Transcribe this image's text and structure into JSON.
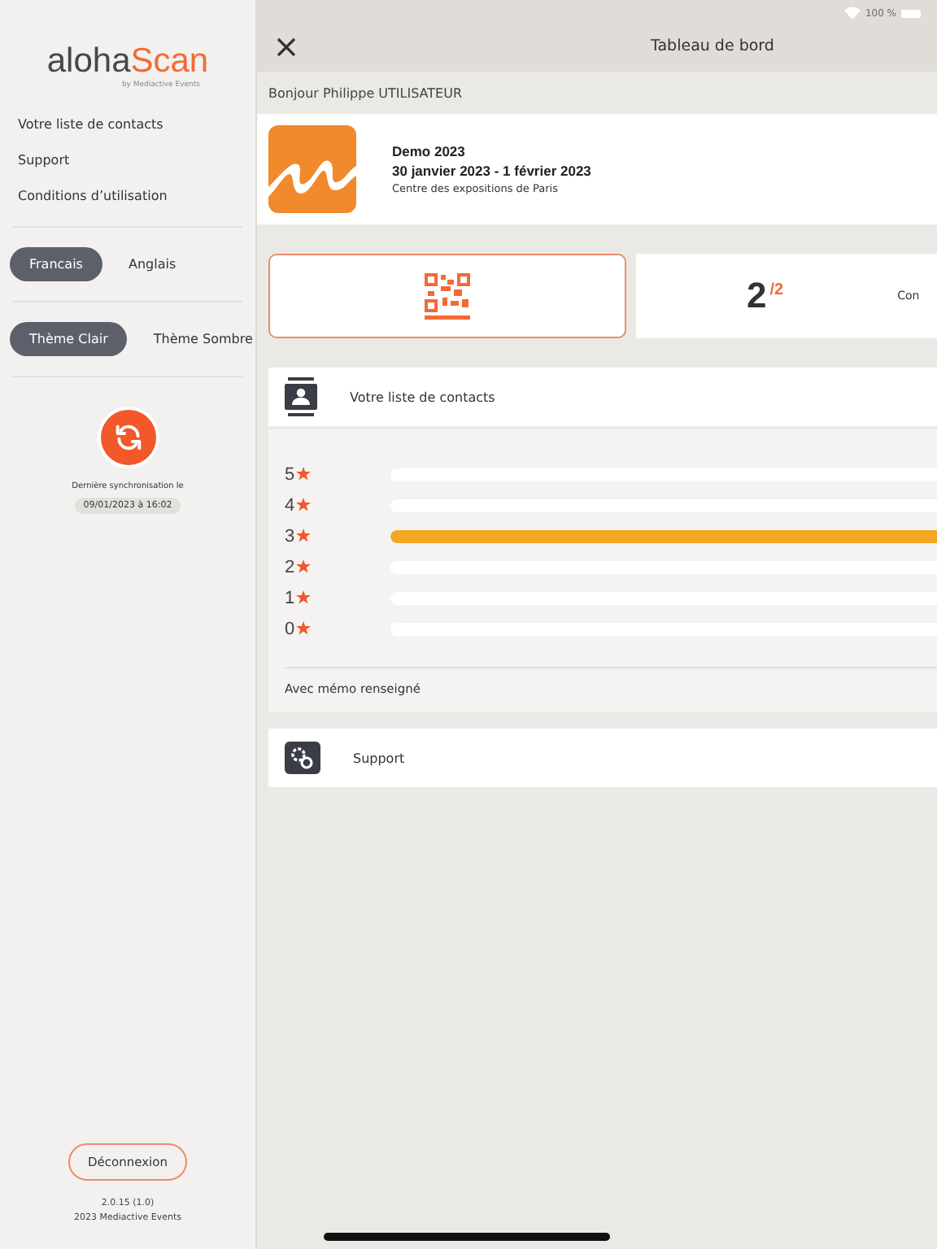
{
  "status_bar": {
    "battery": "100 %"
  },
  "sidebar": {
    "logo": {
      "main": "aloha",
      "accent": "Scan",
      "tagline": "by Mediactive Events"
    },
    "menu": [
      "Votre liste de contacts",
      "Support",
      "Conditions d’utilisation"
    ],
    "languages": [
      {
        "label": "Francais",
        "selected": true
      },
      {
        "label": "Anglais",
        "selected": false
      }
    ],
    "themes": [
      {
        "label": "Thème Clair",
        "selected": true
      },
      {
        "label": "Thème Sombre",
        "selected": false
      }
    ],
    "sync": {
      "label": "Dernière synchronisation le",
      "date": "09/01/2023 à 16:02"
    },
    "logout": "Déconnexion",
    "version": "2.0.15 (1.0)",
    "copyright": "2023 Mediactive Events"
  },
  "header": {
    "title": "Tableau de bord"
  },
  "greeting": "Bonjour Philippe UTILISATEUR",
  "event": {
    "name": "Demo 2023",
    "dates": "30 janvier 2023 - 1 février 2023",
    "venue": "Centre des expositions de Paris"
  },
  "stats": {
    "count": "2",
    "total": "/2",
    "label": "Con"
  },
  "contacts": {
    "title": "Votre liste de contacts"
  },
  "ratings": [
    {
      "label": "5",
      "level": 0
    },
    {
      "label": "4",
      "level": 0
    },
    {
      "label": "3",
      "level": 1
    },
    {
      "label": "2",
      "level": 0
    },
    {
      "label": "1",
      "level": 0
    },
    {
      "label": "0",
      "level": 0
    }
  ],
  "memo": "Avec mémo renseigné",
  "support": {
    "title": "Support"
  }
}
